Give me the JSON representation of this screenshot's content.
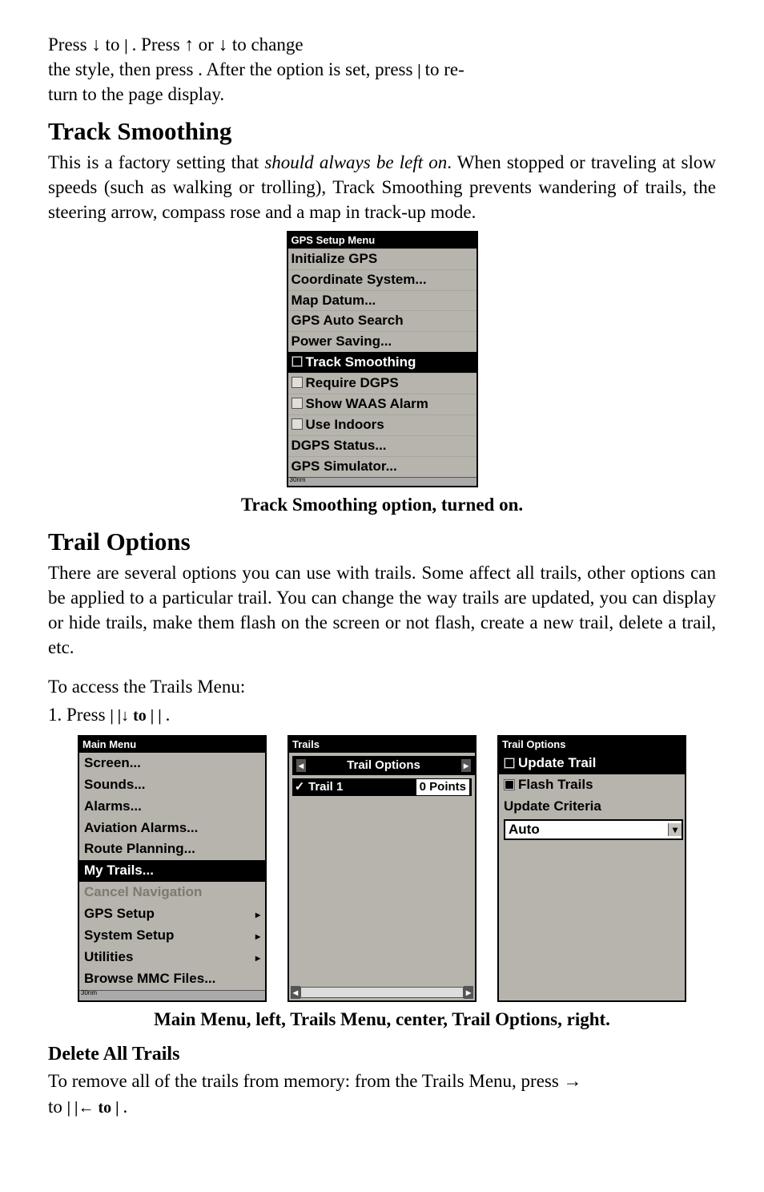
{
  "pagetop": {
    "line1_a": "Press ↓ to ",
    "line1_b": "| ",
    "line1_c": ". Press ↑ or ↓ to change",
    "line2_a": "the style, then press ",
    "line2_b": ". After the option is set, press ",
    "line2_c": "| ",
    "line2_d": "to re-",
    "line3": "turn to the page display."
  },
  "track_smoothing": {
    "heading": "Track Smoothing",
    "body": "This is a factory setting that should always be left on. When stopped or traveling at slow speeds (such as walking or trolling), Track Smoothing prevents wandering of trails, the steering arrow, compass rose and a map in track-up mode.",
    "body_pre_italic": "This is a factory setting that ",
    "body_italic": "should always be left on",
    "body_post_italic": ". When stopped or traveling at slow speeds (such as walking or trolling), Track Smoothing prevents wandering of trails, the steering arrow, compass rose and a map in track-up mode."
  },
  "gps_menu": {
    "title": "GPS Setup Menu",
    "items": [
      {
        "label": "Initialize GPS",
        "selected": false
      },
      {
        "label": "Coordinate System...",
        "selected": false
      },
      {
        "label": "Map Datum...",
        "selected": false
      },
      {
        "label": "GPS Auto Search",
        "selected": false
      },
      {
        "label": "Power Saving...",
        "selected": false
      },
      {
        "label": "Track Smoothing",
        "selected": true,
        "checked": true
      },
      {
        "label": "Require DGPS",
        "selected": false,
        "checked": false,
        "hasCheck": true
      },
      {
        "label": "Show WAAS Alarm",
        "selected": false,
        "checked": false,
        "hasCheck": true
      },
      {
        "label": "Use Indoors",
        "selected": false,
        "checked": false,
        "hasCheck": true
      },
      {
        "label": "DGPS Status...",
        "selected": false
      },
      {
        "label": "GPS Simulator...",
        "selected": false
      }
    ],
    "caption": "Track Smoothing option, turned on."
  },
  "trail_options": {
    "heading": "Trail Options",
    "body": "There are several options you can use with trails. Some affect all trails, other options can be applied to a particular trail. You can change the way trails are updated, you can display or hide trails, make them flash on the screen or not flash, create a new trail, delete a trail, etc.",
    "access_line": "To access the Trails Menu:",
    "step_a": "1. Press ",
    "step_b": "| ",
    "step_c": "|↓ to ",
    "step_d": "| ",
    "step_e": "| ",
    "step_f": "."
  },
  "main_menu": {
    "title": "Main Menu",
    "items": [
      {
        "label": "Screen...",
        "sub": false
      },
      {
        "label": "Sounds...",
        "sub": false
      },
      {
        "label": "Alarms...",
        "sub": false
      },
      {
        "label": "Aviation Alarms...",
        "sub": false
      },
      {
        "label": "Route Planning...",
        "sub": false
      },
      {
        "label": "My Trails...",
        "sub": false,
        "selected": true
      },
      {
        "label": "Cancel Navigation",
        "sub": false,
        "dim": true
      },
      {
        "label": "GPS Setup",
        "sub": true
      },
      {
        "label": "System Setup",
        "sub": true
      },
      {
        "label": "Utilities",
        "sub": true
      },
      {
        "label": "Browse MMC Files...",
        "sub": false
      }
    ]
  },
  "trails_menu": {
    "title": "Trails",
    "option_label": "Trail Options",
    "trail_name": "Trail 1",
    "trail_points": "0 Points"
  },
  "trailopts_menu": {
    "title": "Trail Options",
    "items": [
      {
        "label": "Update Trail",
        "checked": true,
        "selected": true
      },
      {
        "label": "Flash Trails",
        "checked": true,
        "selected": false
      }
    ],
    "criteria_label": "Update Criteria",
    "criteria_value": "Auto"
  },
  "triple_caption": "Main Menu, left, Trails Menu, center, Trail Options, right.",
  "delete_trails": {
    "heading": "Delete All Trails",
    "line1": "To remove all of the trails from memory: from the Trails Menu, press →",
    "line2_a": "to ",
    "line2_b": "| ",
    "line2_c": "|← to ",
    "line2_d": "| ",
    "line2_e": "."
  }
}
